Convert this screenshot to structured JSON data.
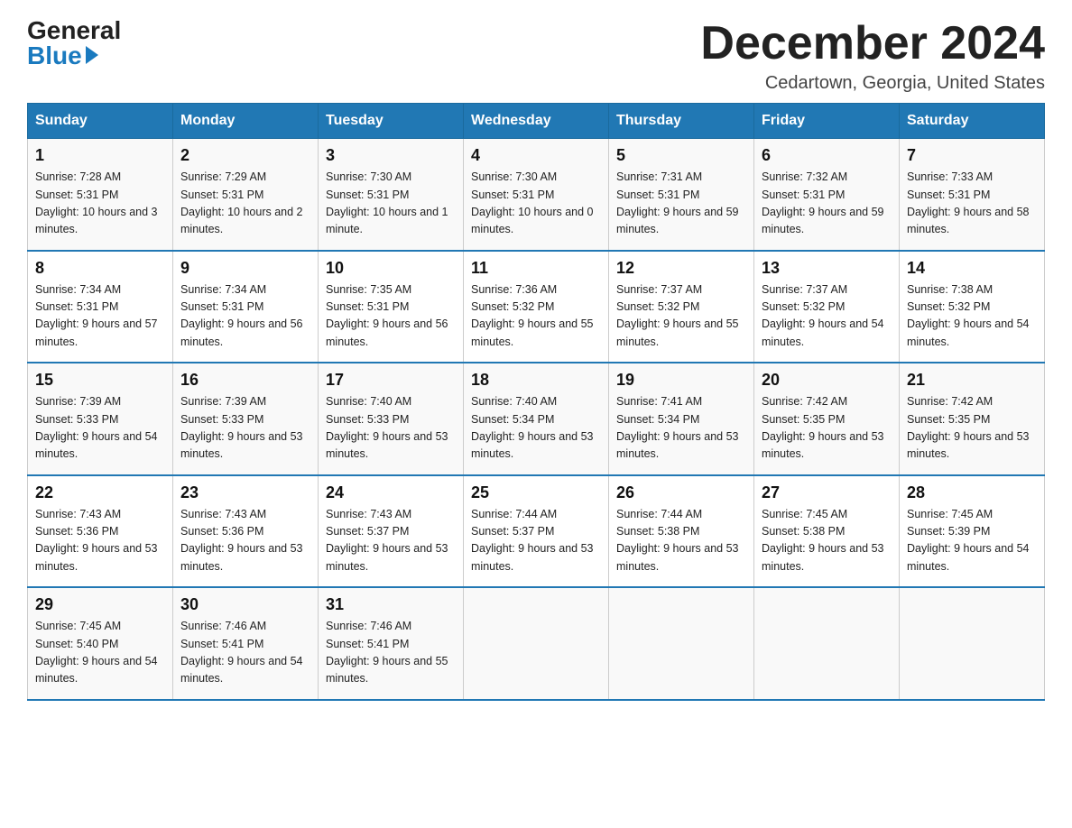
{
  "header": {
    "logo_general": "General",
    "logo_blue": "Blue",
    "month_title": "December 2024",
    "location": "Cedartown, Georgia, United States"
  },
  "weekdays": [
    "Sunday",
    "Monday",
    "Tuesday",
    "Wednesday",
    "Thursday",
    "Friday",
    "Saturday"
  ],
  "weeks": [
    [
      {
        "day": "1",
        "sunrise": "7:28 AM",
        "sunset": "5:31 PM",
        "daylight": "10 hours and 3 minutes."
      },
      {
        "day": "2",
        "sunrise": "7:29 AM",
        "sunset": "5:31 PM",
        "daylight": "10 hours and 2 minutes."
      },
      {
        "day": "3",
        "sunrise": "7:30 AM",
        "sunset": "5:31 PM",
        "daylight": "10 hours and 1 minute."
      },
      {
        "day": "4",
        "sunrise": "7:30 AM",
        "sunset": "5:31 PM",
        "daylight": "10 hours and 0 minutes."
      },
      {
        "day": "5",
        "sunrise": "7:31 AM",
        "sunset": "5:31 PM",
        "daylight": "9 hours and 59 minutes."
      },
      {
        "day": "6",
        "sunrise": "7:32 AM",
        "sunset": "5:31 PM",
        "daylight": "9 hours and 59 minutes."
      },
      {
        "day": "7",
        "sunrise": "7:33 AM",
        "sunset": "5:31 PM",
        "daylight": "9 hours and 58 minutes."
      }
    ],
    [
      {
        "day": "8",
        "sunrise": "7:34 AM",
        "sunset": "5:31 PM",
        "daylight": "9 hours and 57 minutes."
      },
      {
        "day": "9",
        "sunrise": "7:34 AM",
        "sunset": "5:31 PM",
        "daylight": "9 hours and 56 minutes."
      },
      {
        "day": "10",
        "sunrise": "7:35 AM",
        "sunset": "5:31 PM",
        "daylight": "9 hours and 56 minutes."
      },
      {
        "day": "11",
        "sunrise": "7:36 AM",
        "sunset": "5:32 PM",
        "daylight": "9 hours and 55 minutes."
      },
      {
        "day": "12",
        "sunrise": "7:37 AM",
        "sunset": "5:32 PM",
        "daylight": "9 hours and 55 minutes."
      },
      {
        "day": "13",
        "sunrise": "7:37 AM",
        "sunset": "5:32 PM",
        "daylight": "9 hours and 54 minutes."
      },
      {
        "day": "14",
        "sunrise": "7:38 AM",
        "sunset": "5:32 PM",
        "daylight": "9 hours and 54 minutes."
      }
    ],
    [
      {
        "day": "15",
        "sunrise": "7:39 AM",
        "sunset": "5:33 PM",
        "daylight": "9 hours and 54 minutes."
      },
      {
        "day": "16",
        "sunrise": "7:39 AM",
        "sunset": "5:33 PM",
        "daylight": "9 hours and 53 minutes."
      },
      {
        "day": "17",
        "sunrise": "7:40 AM",
        "sunset": "5:33 PM",
        "daylight": "9 hours and 53 minutes."
      },
      {
        "day": "18",
        "sunrise": "7:40 AM",
        "sunset": "5:34 PM",
        "daylight": "9 hours and 53 minutes."
      },
      {
        "day": "19",
        "sunrise": "7:41 AM",
        "sunset": "5:34 PM",
        "daylight": "9 hours and 53 minutes."
      },
      {
        "day": "20",
        "sunrise": "7:42 AM",
        "sunset": "5:35 PM",
        "daylight": "9 hours and 53 minutes."
      },
      {
        "day": "21",
        "sunrise": "7:42 AM",
        "sunset": "5:35 PM",
        "daylight": "9 hours and 53 minutes."
      }
    ],
    [
      {
        "day": "22",
        "sunrise": "7:43 AM",
        "sunset": "5:36 PM",
        "daylight": "9 hours and 53 minutes."
      },
      {
        "day": "23",
        "sunrise": "7:43 AM",
        "sunset": "5:36 PM",
        "daylight": "9 hours and 53 minutes."
      },
      {
        "day": "24",
        "sunrise": "7:43 AM",
        "sunset": "5:37 PM",
        "daylight": "9 hours and 53 minutes."
      },
      {
        "day": "25",
        "sunrise": "7:44 AM",
        "sunset": "5:37 PM",
        "daylight": "9 hours and 53 minutes."
      },
      {
        "day": "26",
        "sunrise": "7:44 AM",
        "sunset": "5:38 PM",
        "daylight": "9 hours and 53 minutes."
      },
      {
        "day": "27",
        "sunrise": "7:45 AM",
        "sunset": "5:38 PM",
        "daylight": "9 hours and 53 minutes."
      },
      {
        "day": "28",
        "sunrise": "7:45 AM",
        "sunset": "5:39 PM",
        "daylight": "9 hours and 54 minutes."
      }
    ],
    [
      {
        "day": "29",
        "sunrise": "7:45 AM",
        "sunset": "5:40 PM",
        "daylight": "9 hours and 54 minutes."
      },
      {
        "day": "30",
        "sunrise": "7:46 AM",
        "sunset": "5:41 PM",
        "daylight": "9 hours and 54 minutes."
      },
      {
        "day": "31",
        "sunrise": "7:46 AM",
        "sunset": "5:41 PM",
        "daylight": "9 hours and 55 minutes."
      },
      null,
      null,
      null,
      null
    ]
  ]
}
